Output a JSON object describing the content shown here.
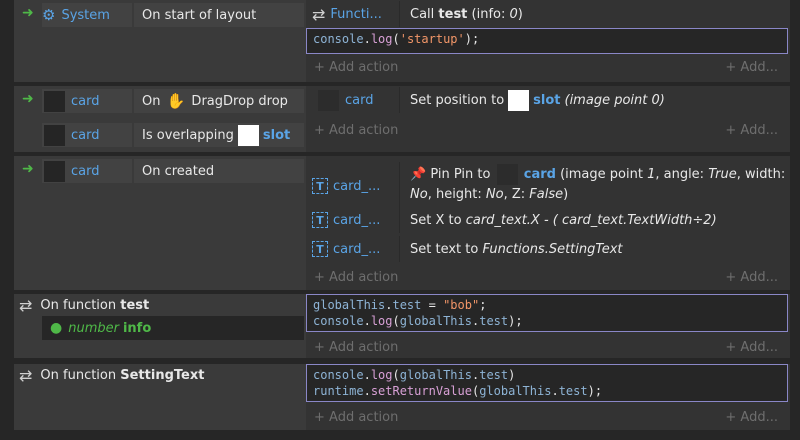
{
  "events": {
    "e1": {
      "object": "System",
      "condition": "On start of layout",
      "action_object": "Functi...",
      "action_text_pre": "Call ",
      "action_text_bold": "test",
      "action_text_post": " (info: ",
      "action_value": "0",
      "action_text_end": ")",
      "js_lines": [
        "console.log('startup');"
      ]
    },
    "e2": {
      "cond1_object": "card",
      "cond1_text_pre": "On ",
      "cond1_text_post": " DragDrop drop",
      "cond2_object": "card",
      "cond2_text": "Is overlapping",
      "cond2_target": "slot",
      "action_object": "card",
      "action_text": "Set position to",
      "action_target": "slot",
      "action_suffix": "(image point 0)"
    },
    "e3": {
      "object": "card",
      "condition": "On created",
      "a1_text_pre": "Pin Pin to",
      "a1_target": "card",
      "a1_line1_pre": "(image point ",
      "a1_val1": "1",
      "a1_line1_mid": ", angle: ",
      "a1_val2": "True",
      "a1_line1_end": ", width:",
      "a1_val3": "No",
      "a1_line2_mid": ", height: ",
      "a1_val4": "No",
      "a1_line2_mid2": ", Z: ",
      "a1_val5": "False",
      "a1_line2_end": ")",
      "a2_object": "card_...",
      "a2_text_pre": "Set X to ",
      "a2_expr": "card_text.X - ( card_text.TextWidth÷2)",
      "a3_object": "card_...",
      "a3_text_pre": "Set text to ",
      "a3_expr": "Functions.SettingText"
    },
    "e4": {
      "title_pre": "On function ",
      "title_bold": "test",
      "param_type": "number",
      "param_name": "info"
    },
    "e5": {
      "title_pre": "On function ",
      "title_bold": "SettingText"
    }
  },
  "add_action": "+ Add action",
  "add_more": "+ Add...",
  "colors": {
    "accent_blue": "#5aa4e6",
    "arrow_green": "#4fb848",
    "js_border": "#8a87c7",
    "string": "#f29668",
    "method": "#d8a0d6",
    "keyword": "#8eb4d6"
  }
}
